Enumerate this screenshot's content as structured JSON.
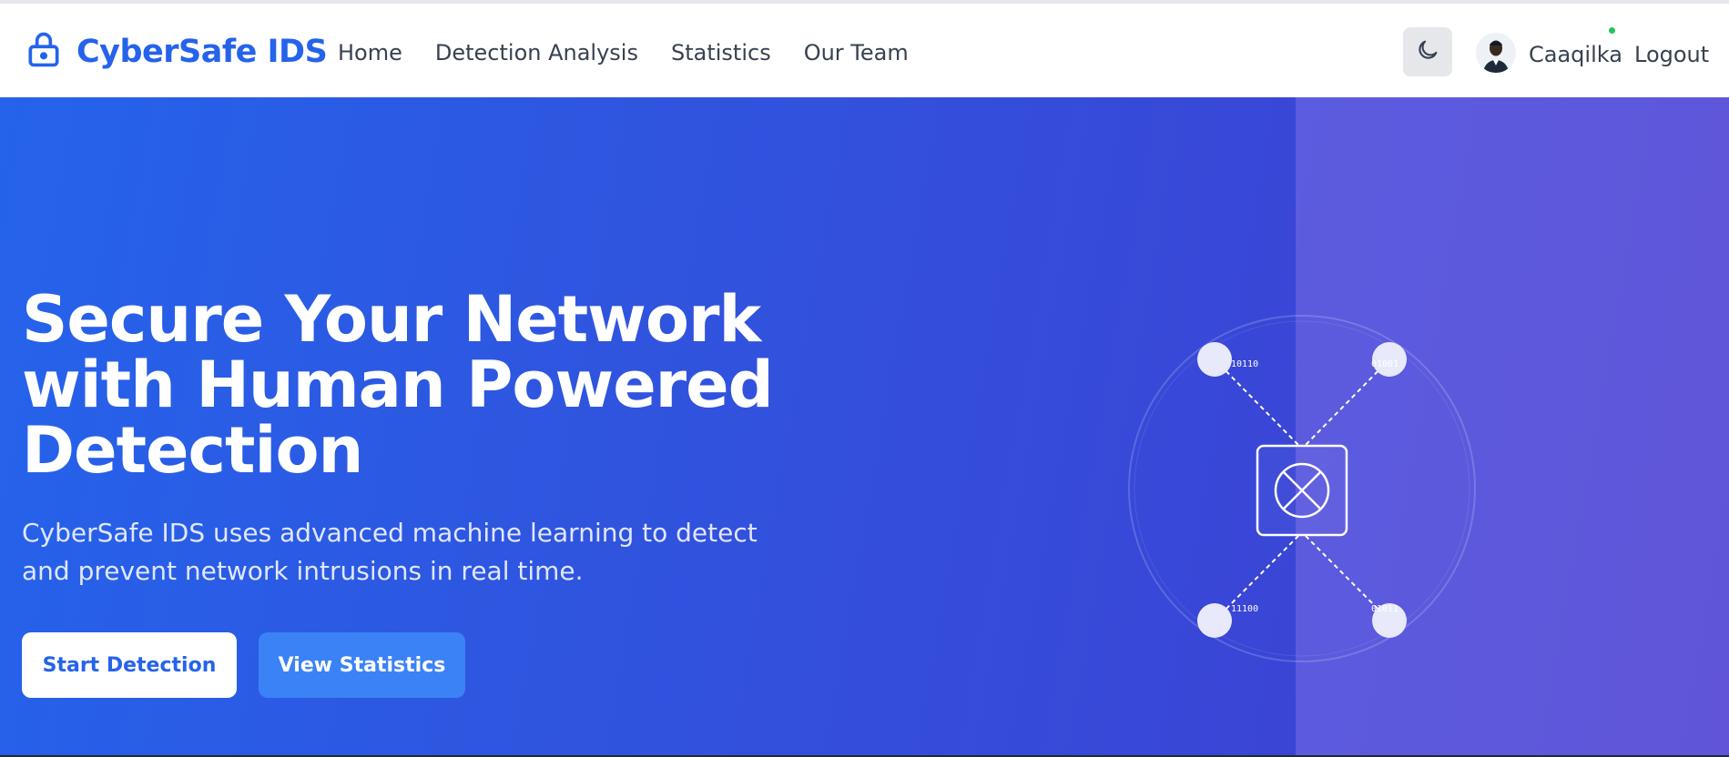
{
  "brand": {
    "title": "CyberSafe IDS",
    "icon": "lock-icon",
    "color": "#2563eb"
  },
  "nav": {
    "links": [
      "Home",
      "Detection Analysis",
      "Statistics",
      "Our Team"
    ]
  },
  "user": {
    "theme_toggle_icon": "moon-icon",
    "name": "Caaqilka",
    "logout_label": "Logout",
    "online_status_color": "#22c55e"
  },
  "hero": {
    "title": "Secure Your Network with Human Powered Detection",
    "subtitle": "CyberSafe IDS uses advanced machine learning to detect and prevent network intrusions in real time.",
    "primary_button": "Start Detection",
    "secondary_button": "View Statistics",
    "gradient_start": "#2563eb",
    "gradient_end": "#4338ca"
  },
  "illustration": {
    "center_icon": "x-circle-icon",
    "node_labels": [
      "10110",
      "01001",
      "11100",
      "01011"
    ]
  }
}
